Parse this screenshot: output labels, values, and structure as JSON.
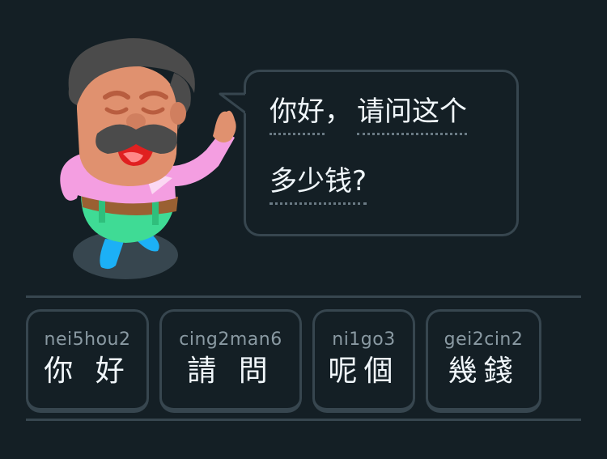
{
  "speech": {
    "words": [
      "你好",
      "请问这个",
      "多少钱?"
    ],
    "separator": "，"
  },
  "tiles": [
    {
      "romanization": "nei5hou2",
      "characters": "你 好"
    },
    {
      "romanization": "cing2man6",
      "characters": "請 問"
    },
    {
      "romanization": "ni1go3",
      "characters": "呢個"
    },
    {
      "romanization": "gei2cin2",
      "characters": "幾錢"
    }
  ],
  "colors": {
    "background": "#141f25",
    "border": "#37464f",
    "text": "#f1f7fb",
    "romanization": "#8a9aa3"
  },
  "icons": {
    "character": "shopkeeper-character-illustration"
  }
}
